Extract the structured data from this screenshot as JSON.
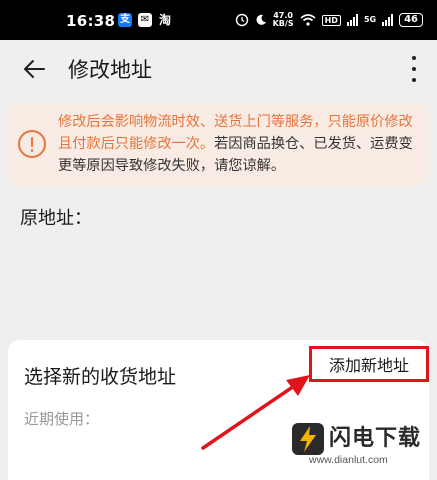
{
  "status_bar": {
    "time": "16:38",
    "app_icons": [
      "alipay-icon",
      "mail-icon",
      "taobao-icon"
    ],
    "taobao_glyph": "淘",
    "net_speed_value": "47.0",
    "net_speed_unit": "KB/S",
    "hd": "HD",
    "sig5g": "5G",
    "battery": "46"
  },
  "header": {
    "title": "修改地址"
  },
  "notice": {
    "text_highlight": "修改后会影响物流时效、送货上门等服务，只能原价修改且付款后只能修改一次。",
    "text_rest": "若因商品换仓、已发货、运费变更等原因导致修改失败，请您谅解。",
    "accent_color": "#e8743b"
  },
  "original_address": {
    "label": "原地址："
  },
  "new_address_card": {
    "title": "选择新的收货地址",
    "add_button_label": "添加新地址",
    "recent_label": "近期使用：",
    "highlight_color": "#e0141c"
  },
  "watermark": {
    "name": "闪电下载",
    "url": "www.dianlut.com"
  }
}
